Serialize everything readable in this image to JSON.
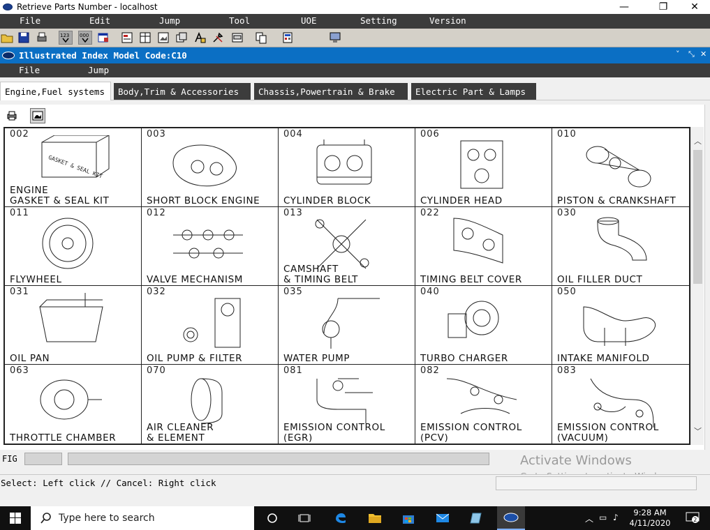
{
  "window": {
    "title": "Retrieve Parts Number - localhost",
    "controls": [
      "—",
      "❐",
      "✕"
    ]
  },
  "menu": [
    "File",
    "Edit",
    "Jump",
    "Tool",
    "UOE",
    "Setting",
    "Version"
  ],
  "toolbar": {
    "icons": [
      "open-folder-icon",
      "save-icon",
      "print-icon",
      "numbers-123-icon",
      "numbers-000-icon",
      "window-icon",
      "form-icon",
      "grid-icon",
      "picture-icon",
      "text-icon",
      "tools-icon",
      "gbp-icon",
      "copy-icon",
      "calculator-icon",
      "monitor-icon"
    ],
    "label_123": "123",
    "label_000": "000"
  },
  "subwindow": {
    "title": "Illustrated Index Model Code:C10",
    "controls": [
      "˅",
      "⤡",
      "✕"
    ]
  },
  "submenu": [
    "File",
    "Jump"
  ],
  "tabs": [
    {
      "label": "Engine,Fuel systems",
      "active": true
    },
    {
      "label": "Body,Trim & Accessories",
      "active": false
    },
    {
      "label": "Chassis,Powertrain & Brake",
      "active": false
    },
    {
      "label": "Electric Part & Lamps",
      "active": false
    }
  ],
  "parts": [
    {
      "code": "002",
      "label": "ENGINE\nGASKET & SEAL KIT",
      "box_text": "GASKET & SEAL KIT"
    },
    {
      "code": "003",
      "label": "SHORT BLOCK ENGINE"
    },
    {
      "code": "004",
      "label": "CYLINDER BLOCK"
    },
    {
      "code": "006",
      "label": "CYLINDER HEAD"
    },
    {
      "code": "010",
      "label": "PISTON & CRANKSHAFT"
    },
    {
      "code": "011",
      "label": "FLYWHEEL"
    },
    {
      "code": "012",
      "label": "VALVE MECHANISM"
    },
    {
      "code": "013",
      "label": "CAMSHAFT\n& TIMING BELT"
    },
    {
      "code": "022",
      "label": "TIMING BELT COVER"
    },
    {
      "code": "030",
      "label": "OIL FILLER DUCT"
    },
    {
      "code": "031",
      "label": "OIL PAN"
    },
    {
      "code": "032",
      "label": "OIL PUMP & FILTER"
    },
    {
      "code": "035",
      "label": "WATER PUMP"
    },
    {
      "code": "040",
      "label": "TURBO CHARGER"
    },
    {
      "code": "050",
      "label": "INTAKE MANIFOLD"
    },
    {
      "code": "063",
      "label": "THROTTLE CHAMBER"
    },
    {
      "code": "070",
      "label": "AIR CLEANER\n& ELEMENT"
    },
    {
      "code": "081",
      "label": "EMISSION CONTROL\n(EGR)"
    },
    {
      "code": "082",
      "label": "EMISSION CONTROL\n(PCV)"
    },
    {
      "code": "083",
      "label": "EMISSION CONTROL\n(VACUUM)"
    }
  ],
  "fig": {
    "label": "FIG",
    "value1": "",
    "value2": ""
  },
  "status": {
    "text": "Select: Left click // Cancel: Right click"
  },
  "watermark": {
    "line1": "Activate Windows",
    "line2": "Go to Settings to activate Windows."
  },
  "taskbar": {
    "search_placeholder": "Type here to search",
    "time": "9:28 AM",
    "date": "4/11/2020",
    "notifications": "2"
  }
}
